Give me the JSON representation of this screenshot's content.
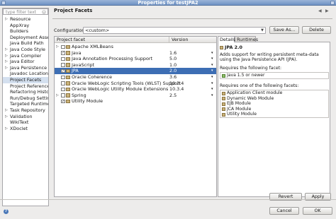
{
  "window": {
    "title": "Properties for testJPA2"
  },
  "sidebar": {
    "search_placeholder": "type filter text",
    "items": [
      {
        "label": "Resource",
        "expandable": true
      },
      {
        "label": "AppXray",
        "expandable": false
      },
      {
        "label": "Builders",
        "expandable": false
      },
      {
        "label": "Deployment Assemb",
        "expandable": false
      },
      {
        "label": "Java Build Path",
        "expandable": false
      },
      {
        "label": "Java Code Style",
        "expandable": true
      },
      {
        "label": "Java Compiler",
        "expandable": true
      },
      {
        "label": "Java Editor",
        "expandable": true
      },
      {
        "label": "Java Persistence",
        "expandable": true
      },
      {
        "label": "Javadoc Location",
        "expandable": false
      },
      {
        "label": "Project Facets",
        "expandable": false,
        "selected": true
      },
      {
        "label": "Project References",
        "expandable": false
      },
      {
        "label": "Refactoring History",
        "expandable": false
      },
      {
        "label": "Run/Debug Settings",
        "expandable": false
      },
      {
        "label": "Targeted Runtimes",
        "expandable": false
      },
      {
        "label": "Task Repository",
        "expandable": true
      },
      {
        "label": "Validation",
        "expandable": true
      },
      {
        "label": "WikiText",
        "expandable": false
      },
      {
        "label": "XDoclet",
        "expandable": true
      }
    ]
  },
  "page": {
    "title": "Project Facets"
  },
  "configuration": {
    "label": "Configuration:",
    "value": "<custom>",
    "save_as_label": "Save As...",
    "delete_label": "Delete"
  },
  "facets_table": {
    "col_facet": "Project facet",
    "col_version": "Version",
    "rows": [
      {
        "name": "Apache XMLBeans",
        "version": "",
        "checked": false,
        "expandable": true,
        "selected": false
      },
      {
        "name": "Java",
        "version": "1.6",
        "checked": true,
        "expandable": false,
        "selected": false
      },
      {
        "name": "Java Annotation Processing Support",
        "version": "5.0",
        "checked": false,
        "expandable": false,
        "selected": false
      },
      {
        "name": "JavaScript",
        "version": "1.0",
        "checked": false,
        "expandable": false,
        "selected": false
      },
      {
        "name": "JPA",
        "version": "2.0",
        "checked": true,
        "expandable": false,
        "selected": true
      },
      {
        "name": "Oracle Coherence",
        "version": "3.6",
        "checked": false,
        "expandable": false,
        "selected": false
      },
      {
        "name": "Oracle WebLogic Scripting Tools (WLST) Support",
        "version": "10.3.4",
        "checked": false,
        "expandable": false,
        "selected": false
      },
      {
        "name": "Oracle WebLogic Utility Module Extensions",
        "version": "10.3.4",
        "checked": false,
        "expandable": false,
        "selected": false
      },
      {
        "name": "Spring",
        "version": "2.5",
        "checked": false,
        "expandable": true,
        "selected": false
      },
      {
        "name": "Utility Module",
        "version": "",
        "checked": true,
        "expandable": false,
        "selected": false
      }
    ]
  },
  "details": {
    "tab_details": "Details",
    "tab_runtimes": "Runtimes",
    "facet_title": "JPA 2.0",
    "description": "Adds support for writing persistent meta-data using the Java Persistence API (JPA).",
    "requires_label": "Requires the following facet:",
    "requires": [
      "Java 1.5 or newer"
    ],
    "requires_one_label": "Requires one of the following facets:",
    "requires_one": [
      "Application Client module",
      "Dynamic Web Module",
      "EJB Module",
      "JCA Module",
      "Utility Module"
    ]
  },
  "buttons": {
    "revert": "Revert",
    "apply": "Apply",
    "cancel": "Cancel",
    "ok": "OK"
  },
  "icons": {
    "help": "help-icon",
    "back": "back-arrow-icon",
    "forward": "forward-arrow-icon",
    "clear": "clear-icon",
    "facet": "facet-icon"
  },
  "colors": {
    "selection": "#3d6eb4",
    "sidebar_selection": "#d4e0ef"
  }
}
